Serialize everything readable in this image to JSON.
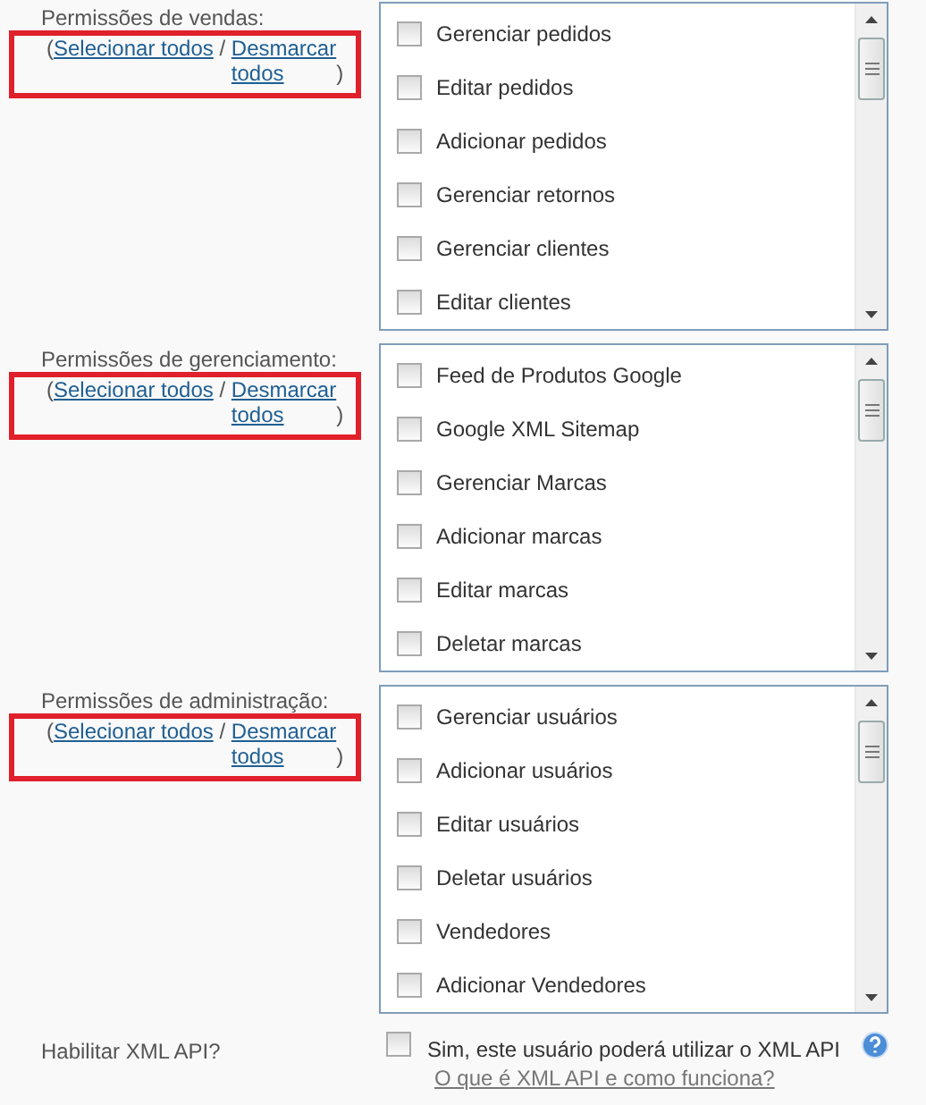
{
  "sections": [
    {
      "label": "Permissões de vendas:",
      "open": "(",
      "select_all": "Selecionar todos",
      "separator": "/",
      "deselect_all": "Desmarcar todos",
      "close": ")",
      "highlighted": true,
      "items": [
        {
          "label": "Gerenciar pedidos",
          "checked": false
        },
        {
          "label": "Editar pedidos",
          "checked": false
        },
        {
          "label": "Adicionar pedidos",
          "checked": false
        },
        {
          "label": "Gerenciar retornos",
          "checked": false
        },
        {
          "label": "Gerenciar clientes",
          "checked": false
        },
        {
          "label": "Editar clientes",
          "checked": false
        }
      ]
    },
    {
      "label": "Permissões de gerenciamento:",
      "open": "(",
      "select_all": "Selecionar todos",
      "separator": "/",
      "deselect_all": "Desmarcar todos",
      "close": ")",
      "highlighted": true,
      "items": [
        {
          "label": "Feed de Produtos Google",
          "checked": false
        },
        {
          "label": "Google XML Sitemap",
          "checked": false
        },
        {
          "label": "Gerenciar Marcas",
          "checked": false
        },
        {
          "label": "Adicionar marcas",
          "checked": false
        },
        {
          "label": "Editar marcas",
          "checked": false
        },
        {
          "label": "Deletar marcas",
          "checked": false
        }
      ]
    },
    {
      "label": "Permissões de administração:",
      "open": "(",
      "select_all": "Selecionar todos",
      "separator": "/",
      "deselect_all": "Desmarcar todos",
      "close": ")",
      "highlighted": true,
      "items": [
        {
          "label": "Gerenciar usuários",
          "checked": false
        },
        {
          "label": "Adicionar usuários",
          "checked": false
        },
        {
          "label": "Editar usuários",
          "checked": false
        },
        {
          "label": "Deletar usuários",
          "checked": false
        },
        {
          "label": "Vendedores",
          "checked": false
        },
        {
          "label": "Adicionar Vendedores",
          "checked": false
        }
      ]
    }
  ],
  "xml_api": {
    "label": "Habilitar XML API?",
    "option": "Sim, este usuário poderá utilizar o XML API",
    "checked": false,
    "help_link": "O que é XML API e como funciona?"
  }
}
